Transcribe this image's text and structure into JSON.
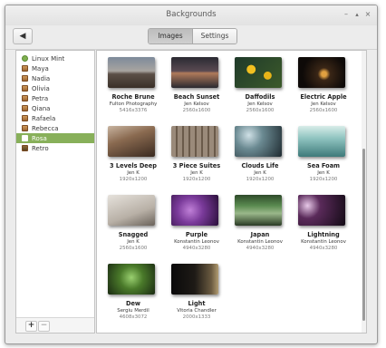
{
  "window": {
    "title": "Backgrounds",
    "min_glyph": "–",
    "max_glyph": "▴",
    "close_glyph": "×"
  },
  "toolbar": {
    "back_glyph": "◀",
    "tabs": [
      "Images",
      "Settings"
    ],
    "active_tab": "Images"
  },
  "sidebar": {
    "items": [
      {
        "label": "Linux Mint",
        "icon": "mint-icon"
      },
      {
        "label": "Maya",
        "icon": "folder-icon"
      },
      {
        "label": "Nadia",
        "icon": "folder-icon"
      },
      {
        "label": "Olivia",
        "icon": "folder-icon"
      },
      {
        "label": "Petra",
        "icon": "folder-icon"
      },
      {
        "label": "Qiana",
        "icon": "folder-icon"
      },
      {
        "label": "Rafaela",
        "icon": "folder-icon"
      },
      {
        "label": "Rebecca",
        "icon": "folder-icon"
      },
      {
        "label": "Rosa",
        "icon": "folder-icon"
      },
      {
        "label": "Retro",
        "icon": "folder-icon"
      }
    ],
    "selected": "Rosa",
    "add_label": "+",
    "remove_label": "−"
  },
  "backgrounds": [
    {
      "name": "Roche Brune",
      "author": "Fulton Photography",
      "resolution": "5416x3376"
    },
    {
      "name": "Beach Sunset",
      "author": "Jen Kelsov",
      "resolution": "2560x1600"
    },
    {
      "name": "Daffodils",
      "author": "Jen Kelsov",
      "resolution": "2560x1600"
    },
    {
      "name": "Electric Apple",
      "author": "Jen Kelsov",
      "resolution": "2560x1600"
    },
    {
      "name": "3 Levels Deep",
      "author": "Jen K",
      "resolution": "1920x1200"
    },
    {
      "name": "3 Piece Suites",
      "author": "Jen K",
      "resolution": "1920x1200"
    },
    {
      "name": "Clouds Life",
      "author": "Jen K",
      "resolution": "1920x1200"
    },
    {
      "name": "Sea Foam",
      "author": "Jen K",
      "resolution": "1920x1200"
    },
    {
      "name": "Snagged",
      "author": "Jen K",
      "resolution": "2560x1600"
    },
    {
      "name": "Purple",
      "author": "Konstantin Leonov",
      "resolution": "4940x3280"
    },
    {
      "name": "Japan",
      "author": "Konstantin Leonov",
      "resolution": "4940x3280"
    },
    {
      "name": "Lightning",
      "author": "Konstantin Leonov",
      "resolution": "4940x3280"
    },
    {
      "name": "Dew",
      "author": "Sergiu Merdil",
      "resolution": "4608x3072"
    },
    {
      "name": "Light",
      "author": "Vitoria Chandler",
      "resolution": "2000x1333"
    }
  ],
  "colors": {
    "selection": "#88b05a",
    "window_bg": "#ececec"
  }
}
